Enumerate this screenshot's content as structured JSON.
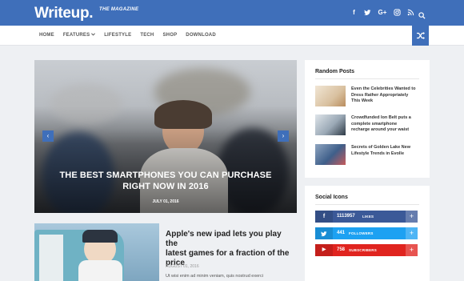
{
  "header": {
    "logo": "Writeup.",
    "tagline": "THE MAGAZINE",
    "social_icons": [
      "facebook-icon",
      "twitter-icon",
      "google-plus-icon",
      "instagram-icon",
      "rss-icon"
    ],
    "accent_color": "#3f6fba"
  },
  "nav": {
    "items": [
      "HOME",
      "FEATURES",
      "LIFESTYLE",
      "TECH",
      "SHOP",
      "DOWNLOAD"
    ],
    "dropdown_item": "FEATURES"
  },
  "slider": {
    "title_line1": "THE BEST SMARTPHONES YOU CAN PURCHASE",
    "title_line2": "RIGHT NOW IN 2016",
    "date": "JULY 01, 2016"
  },
  "featured_post": {
    "title_line1": "Apple's new ipad lets you play the",
    "title_line2": "latest games for a fraction of the",
    "title_line3": "price",
    "date": "AUGUST 01, 2016",
    "excerpt": "Ut wisi enim ad minim veniam, quis nostrud exerci"
  },
  "random_posts": {
    "title": "Random Posts",
    "items": [
      {
        "line1": "Even the Celebrities Wanted to",
        "line2": "Dress Rather Appropriately",
        "line3": "This Week"
      },
      {
        "line1": "Crowdfunded Ion Belt puts a",
        "line2": "complete smartphone",
        "line3": "recharge around your waist"
      },
      {
        "line1": "Secrets of Golden Lake New",
        "line2": "Lifestyle Trends in Evolle",
        "line3": ""
      }
    ]
  },
  "social_widget": {
    "title": "Social Icons",
    "bars": [
      {
        "icon": "facebook-icon",
        "glyph": "f",
        "count": "1113957",
        "label": "LIKES",
        "color": "#3b5998"
      },
      {
        "icon": "twitter-icon",
        "glyph": "t",
        "count": "441",
        "label": "FOLLOWERS",
        "color": "#1da1f2"
      },
      {
        "icon": "youtube-icon",
        "glyph": "▶",
        "count": "758",
        "label": "SUBSCRIBERS",
        "color": "#e0241f"
      }
    ],
    "plus": "+"
  },
  "arrows": {
    "left": "‹",
    "right": "›"
  }
}
